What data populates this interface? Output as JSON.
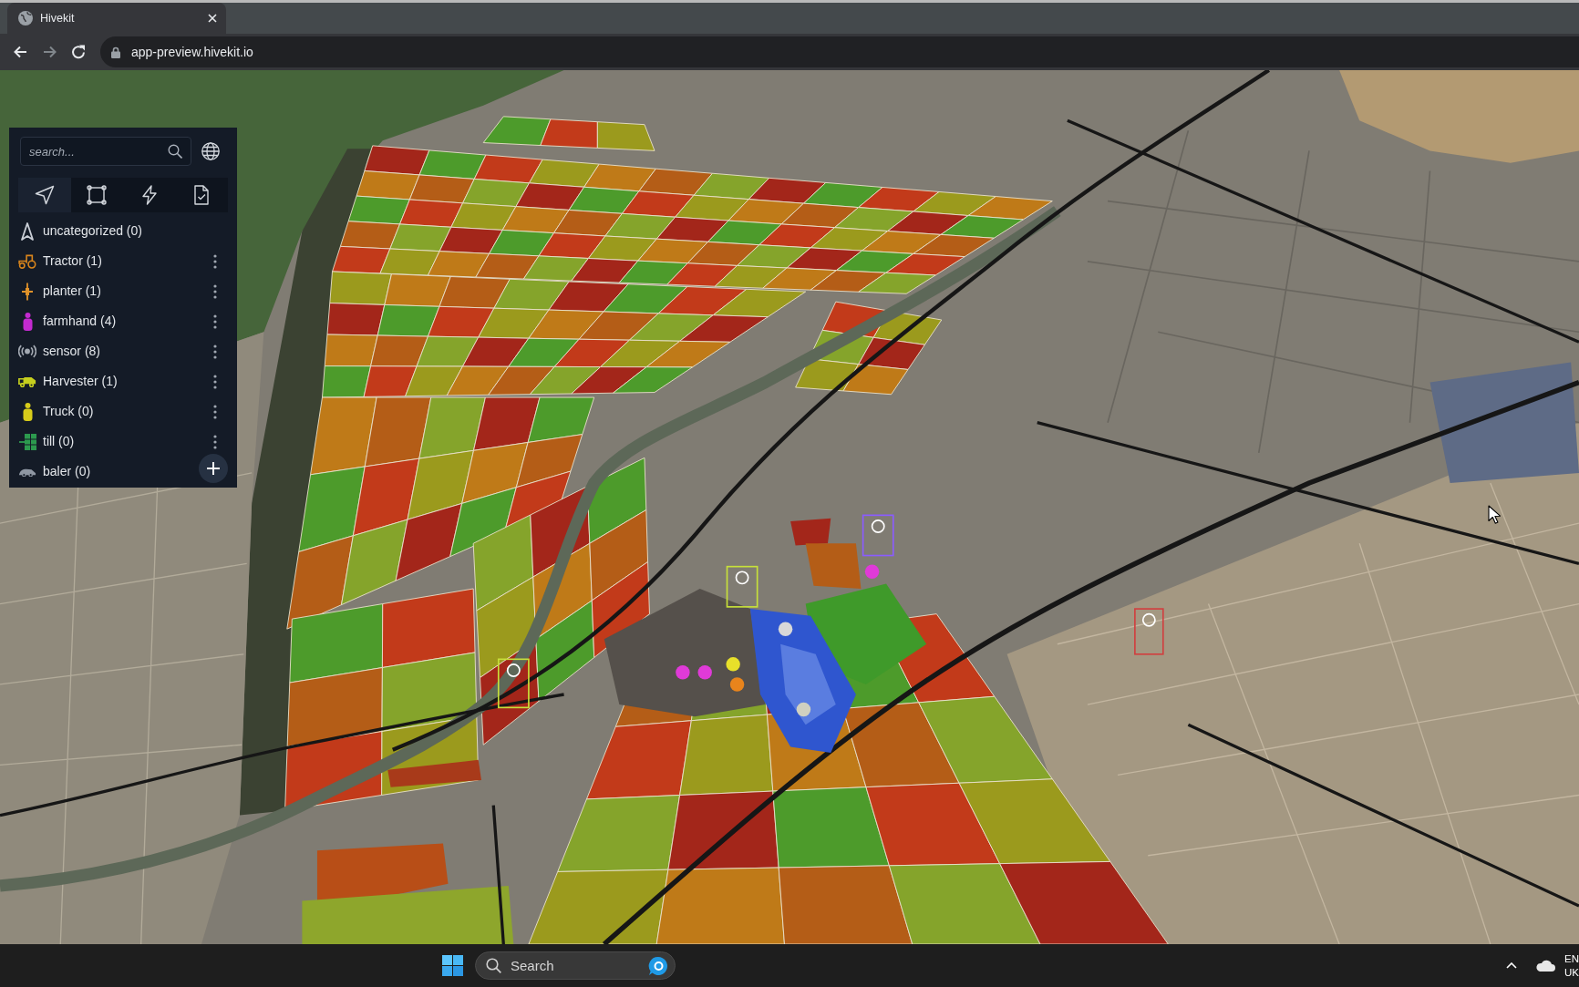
{
  "browser": {
    "tabs": [
      {
        "title": "Hivekit",
        "selected": true
      }
    ],
    "nav_buttons": [
      {
        "kind": "back",
        "disabled": false
      },
      {
        "kind": "forward",
        "disabled": true
      },
      {
        "kind": "reload",
        "disabled": false
      }
    ],
    "address": "app-preview.hivekit.io"
  },
  "panel": {
    "search": {
      "placeholder": "search..."
    },
    "tabs": [
      {
        "kind": "locate",
        "selected": true
      },
      {
        "kind": "area",
        "selected": false
      },
      {
        "kind": "trigger",
        "selected": false
      },
      {
        "kind": "task",
        "selected": false
      }
    ],
    "categories": [
      {
        "kind": "uncategorized",
        "label": "uncategorized (0)",
        "color": "#c9ced6",
        "menu": false
      },
      {
        "kind": "tractor",
        "label": "Tractor (1)",
        "color": "#d9851c",
        "menu": true
      },
      {
        "kind": "planter",
        "label": "planter (1)",
        "color": "#e0922a",
        "menu": true
      },
      {
        "kind": "person",
        "label": "farmhand (4)",
        "color": "#c42ad0",
        "menu": true
      },
      {
        "kind": "sensor",
        "label": "sensor (8)",
        "color": "#a3a9b2",
        "menu": true
      },
      {
        "kind": "harvester",
        "label": "Harvester (1)",
        "color": "#c6cf1e",
        "menu": true
      },
      {
        "kind": "person",
        "label": "Truck (0)",
        "color": "#d8cc1a",
        "menu": true
      },
      {
        "kind": "till",
        "label": "till (0)",
        "color": "#2c9a4e",
        "menu": true
      },
      {
        "kind": "baler",
        "label": "baler (0)",
        "color": "#8f97a3",
        "menu": false
      }
    ]
  },
  "taskbar": {
    "search": {
      "placeholder": "Search"
    },
    "language": "EN",
    "layout": "UK"
  }
}
